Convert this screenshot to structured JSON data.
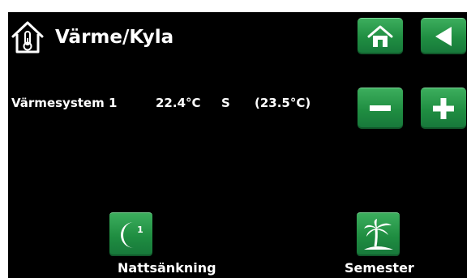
{
  "header": {
    "title": "Värme/Kyla",
    "icon": "house-thermometer-icon"
  },
  "nav": {
    "home_icon": "home-icon",
    "back_icon": "back-arrow-icon"
  },
  "heating_system": {
    "name": "Värmesystem 1",
    "current_temp": "22.4°C",
    "mode": "S",
    "setpoint": "(23.5°C)"
  },
  "controls": {
    "decrease_icon": "minus-icon",
    "increase_icon": "plus-icon"
  },
  "bottom": {
    "night_label": "Nattsänkning",
    "night_badge": "1",
    "night_icon": "moon-icon",
    "vacation_label": "Semester",
    "vacation_icon": "palm-tree-icon"
  },
  "colors": {
    "button_green": "#23984a",
    "background": "#000000",
    "text": "#ffffff"
  }
}
